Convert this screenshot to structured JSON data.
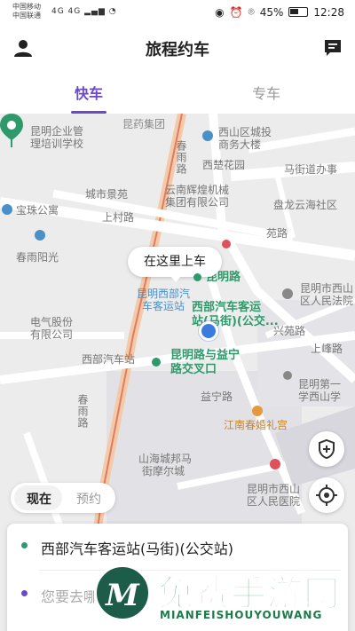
{
  "status_bar": {
    "carrier1": "中国移动",
    "carrier2": "中国联通",
    "signal": "4G 4G",
    "battery_percent": "45%",
    "battery_level": 0.45,
    "time": "12:28"
  },
  "header": {
    "title": "旅程约车",
    "user_icon": "user-icon",
    "message_icon": "message-icon"
  },
  "tabs": [
    {
      "label": "快车",
      "active": true
    },
    {
      "label": "专车",
      "active": false
    }
  ],
  "map": {
    "labels": {
      "kunxiu": "昆药集团",
      "xishan_district": "西山区城投",
      "xishan_building": "商务大楼",
      "peixun1": "昆明企业管",
      "peixun2": "理培训学校",
      "chunyu_road": "春雨路",
      "xichuyuan": "西楚花园",
      "yunnan_hh1": "云南辉煌机械",
      "yunnan_hh2": "集团有限公司",
      "majie_road": "马街道办事",
      "city_garden": "城市景苑",
      "baozhu": "宝珠公寓",
      "panlong": "盘龙云海社区",
      "shangcun": "上村路",
      "yuanyuan": "苑路",
      "chunyu_yangguang": "春雨阳光",
      "kunming_road": "昆明路",
      "kunming_xibu1": "昆明西部汽",
      "kunming_xibu2": "车客运站",
      "xibu_station1": "西部汽车客运",
      "xibu_station2": "站(马街)(公交...",
      "court1": "昆明市西山",
      "court2": "区人民法院",
      "electric1": "电气股份",
      "electric2": "有限公司",
      "xingyuan": "兴苑路",
      "shangfeng": "上峰路",
      "xibu_stop": "西部汽车站",
      "kunming_yining1": "昆明路与益宁",
      "kunming_yining2": "路交叉口",
      "school1": "昆明第一",
      "school2": "学西山学",
      "yining": "益宁路",
      "chunyu_road2": "春雨路",
      "jiangnan": "江南春婚礼宫",
      "shanhai1": "山海城邦马",
      "shanhai2": "街摩尔城",
      "hospital1": "昆明市西山",
      "hospital2": "区人民医院"
    },
    "pickup_bubble": "在这里上车",
    "shield_icon": "shield-plus-icon",
    "locate_icon": "locate-icon"
  },
  "time_tabs": {
    "now": "现在",
    "book": "预约"
  },
  "trip_card": {
    "from": "西部汽车客运站(马街)(公交站)",
    "to_placeholder": "您要去哪儿"
  },
  "watermark": {
    "logo_letter": "M",
    "text_cn": "免费手游网",
    "text_en": "MIANFEISHOUYOUWANG"
  }
}
